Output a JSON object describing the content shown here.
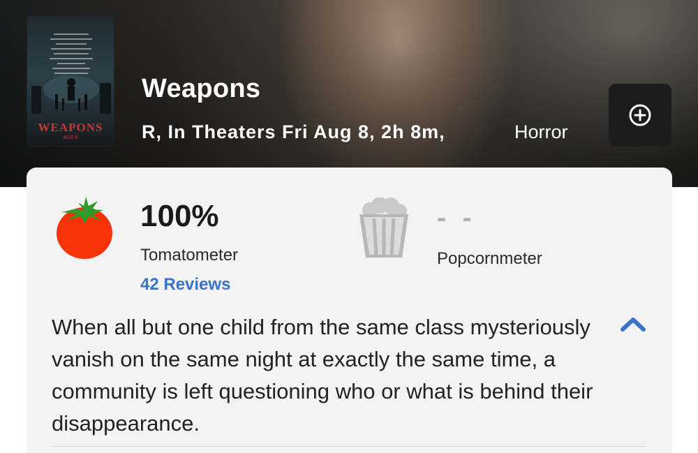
{
  "movie": {
    "title": "Weapons",
    "meta": "R, In Theaters Fri Aug 8, 2h 8m,",
    "genre": "Horror",
    "poster_title": "WEAPONS",
    "poster_date": "AUG 8"
  },
  "scores": {
    "tomatometer_value": "100%",
    "tomatometer_label": "Tomatometer",
    "reviews_link": "42 Reviews",
    "popcornmeter_value": "- -",
    "popcornmeter_label": "Popcornmeter"
  },
  "synopsis": "When all but one child from the same class mysteriously vanish on the same night at exactly the same time, a community is left questioning who or what is behind their disappearance.",
  "icons": {
    "add": "plus-circle-icon",
    "tomato": "fresh-tomato-icon",
    "popcorn": "empty-popcorn-bucket-icon",
    "collapse": "chevron-up-icon"
  },
  "colors": {
    "accent_link": "#3a73c9",
    "tomato_red": "#f93208",
    "card_bg": "#f3f3f3"
  }
}
